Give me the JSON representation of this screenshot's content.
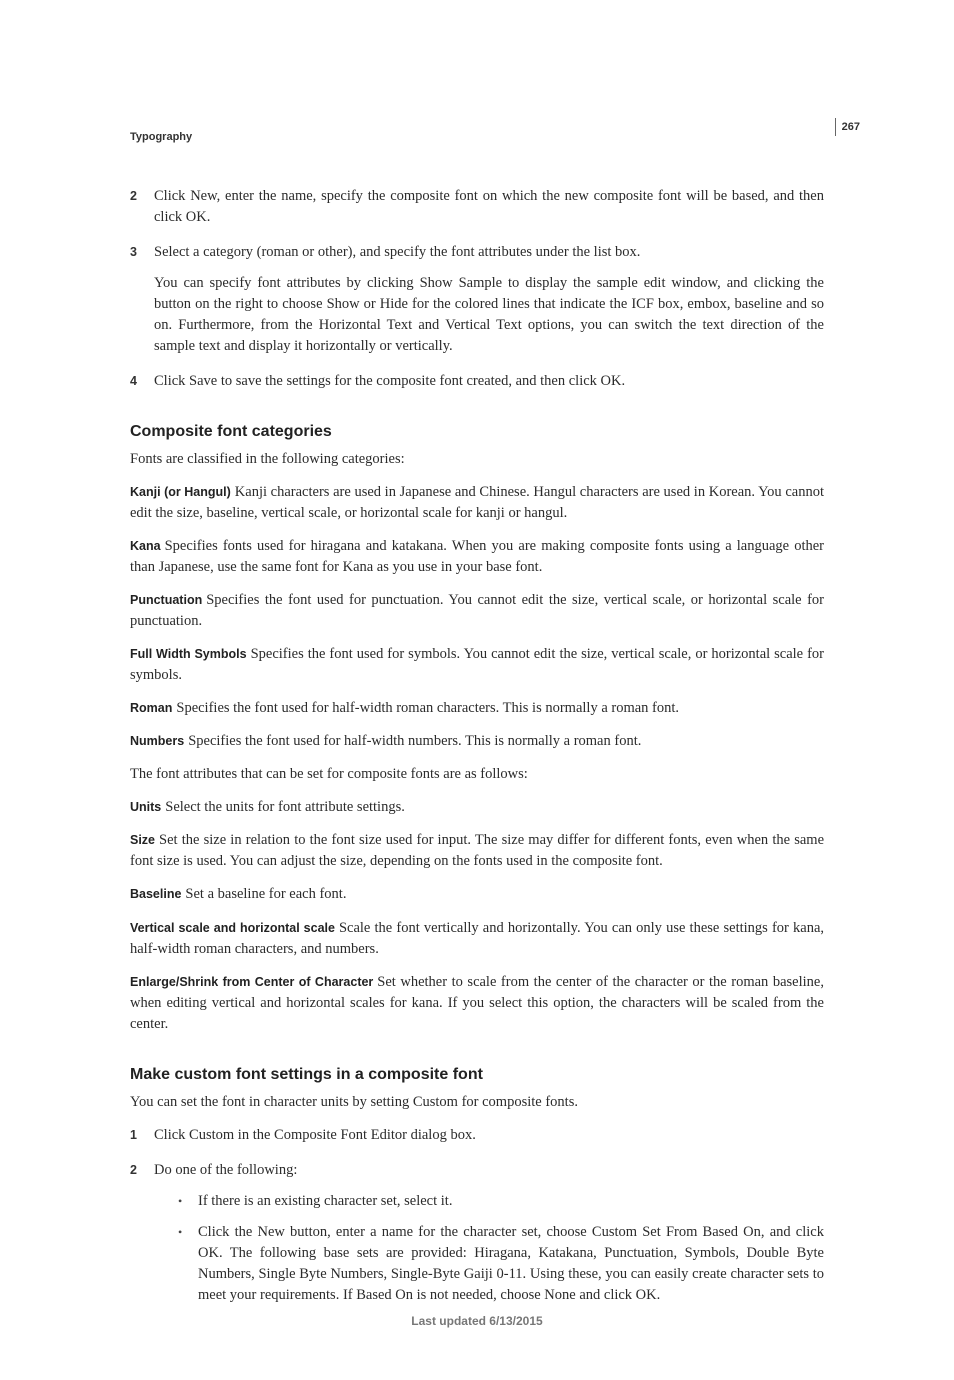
{
  "page_number": "267",
  "chapter": "Typography",
  "top_steps": [
    {
      "num": "2",
      "paras": [
        "Click New, enter the name, specify the composite font on which the new composite font will be based, and then click OK."
      ]
    },
    {
      "num": "3",
      "paras": [
        "Select a category (roman or other), and specify the font attributes under the list box.",
        "You can specify font attributes by clicking Show Sample to display the sample edit window, and clicking the button on the right to choose Show or Hide for the colored lines that indicate the ICF box, embox, baseline and so on. Furthermore, from the Horizontal Text and Vertical Text options, you can switch the text direction of the sample text and display it horizontally or vertically."
      ]
    },
    {
      "num": "4",
      "paras": [
        "Click Save to save the settings for the composite font created, and then click OK."
      ]
    }
  ],
  "section1": {
    "heading": "Composite font categories",
    "intro": "Fonts are classified in the following categories:",
    "terms": [
      {
        "term": "Kanji (or Hangul)",
        "text": "Kanji characters are used in Japanese and Chinese. Hangul characters are used in Korean. You cannot edit the size, baseline, vertical scale, or horizontal scale for kanji or hangul."
      },
      {
        "term": "Kana",
        "text": "Specifies fonts used for hiragana and katakana. When you are making composite fonts using a language other than Japanese, use the same font for Kana as you use in your base font."
      },
      {
        "term": "Punctuation",
        "text": "Specifies the font used for punctuation. You cannot edit the size, vertical scale, or horizontal scale for punctuation."
      },
      {
        "term": "Full Width Symbols",
        "text": "Specifies the font used for symbols. You cannot edit the size, vertical scale, or horizontal scale for symbols."
      },
      {
        "term": "Roman",
        "text": "Specifies the font used for half-width roman characters. This is normally a roman font."
      },
      {
        "term": "Numbers",
        "text": "Specifies the font used for half-width numbers. This is normally a roman font."
      }
    ],
    "attr_intro": "The font attributes that can be set for composite fonts are as follows:",
    "attrs": [
      {
        "term": "Units",
        "text": "Select the units for font attribute settings."
      },
      {
        "term": "Size",
        "text": "Set the size in relation to the font size used for input. The size may differ for different fonts, even when the same font size is used. You can adjust the size, depending on the fonts used in the composite font."
      },
      {
        "term": "Baseline",
        "text": "Set a baseline for each font."
      },
      {
        "term": "Vertical scale and horizontal scale",
        "text": "Scale the font vertically and horizontally. You can only use these settings for kana, half-width roman characters, and numbers."
      },
      {
        "term": "Enlarge/Shrink from Center of Character",
        "text": "Set whether to scale from the center of the character or the roman baseline, when editing vertical and horizontal scales for kana. If you select this option, the characters will be scaled from the center."
      }
    ]
  },
  "section2": {
    "heading": "Make custom font settings in a composite font",
    "intro": "You can set the font in character units by setting Custom for composite fonts.",
    "steps": [
      {
        "num": "1",
        "text": "Click Custom in the Composite Font Editor dialog box."
      },
      {
        "num": "2",
        "text": "Do one of the following:"
      }
    ],
    "sublist": [
      "If there is an existing character set, select it.",
      "Click the New button, enter a name for the character set, choose Custom Set From Based On, and click OK. The following base sets are provided: Hiragana, Katakana, Punctuation, Symbols, Double Byte Numbers, Single Byte Numbers, Single-Byte Gaiji 0-11. Using these, you can easily create character sets to meet your requirements. If Based On is not needed, choose None and click OK."
    ]
  },
  "footer": "Last updated 6/13/2015"
}
